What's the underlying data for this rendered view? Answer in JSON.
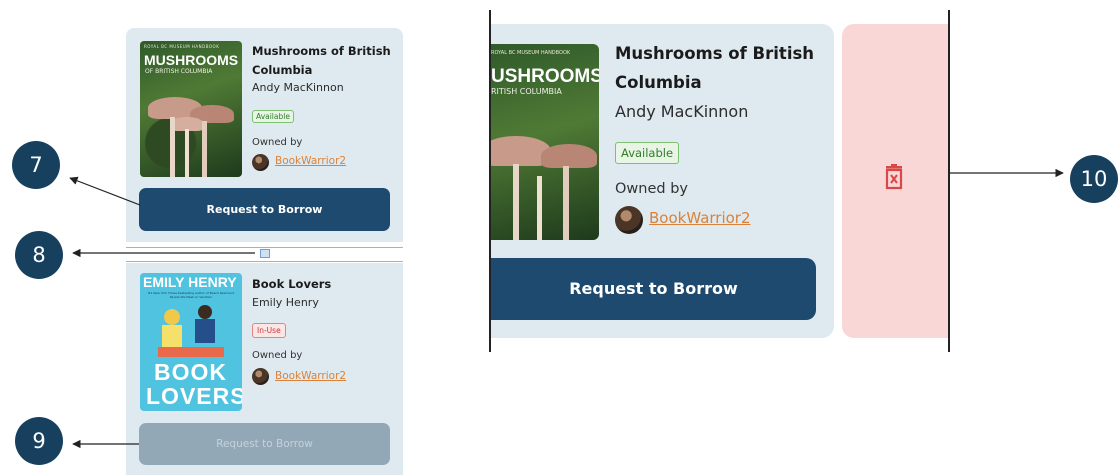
{
  "left_cards": [
    {
      "cover": {
        "series": "ROYAL BC MUSEUM HANDBOOK",
        "title_line1": "MUSHROOMS",
        "title_line2": "OF BRITISH COLUMBIA"
      },
      "title": "Mushrooms of British Columbia",
      "author": "Andy MacKinnon",
      "status": "Available",
      "owned_by": "Owned by",
      "owner": "BookWarrior2",
      "button": "Request to Borrow",
      "button_state": "enabled"
    },
    {
      "cover": {
        "author_line": "EMILY HENRY",
        "tagline": "#1 New York Times bestselling author of Beach Read and People We Meet on Vacation",
        "title_line1": "BOOK",
        "title_line2": "LOVERS"
      },
      "title": "Book Lovers",
      "author": "Emily Henry",
      "status": "In-Use",
      "owned_by": "Owned by",
      "owner": "BookWarrior2",
      "button": "Request to Borrow",
      "button_state": "disabled"
    }
  ],
  "zoom_card": {
    "cover": {
      "series": "ROYAL BC MUSEUM HANDBOOK",
      "title_line1": "USHROOMS",
      "title_line2": "RITISH COLUMBIA"
    },
    "title_line1": "Mushrooms of British",
    "title_line2": "Columbia",
    "author": "Andy MacKinnon",
    "status": "Available",
    "owned_by": "Owned by",
    "owner": "BookWarrior2",
    "button": "Request to Borrow"
  },
  "delete_icon": "trash-x-icon",
  "markers": {
    "m7": "7",
    "m8": "8",
    "m9": "9",
    "m10": "10"
  },
  "colors": {
    "card_bg": "#dfe9f0",
    "primary": "#1d4a6e",
    "disabled": "#93a8b7",
    "marker": "#17405f",
    "delete_bg": "#f9d7d7",
    "delete_icon": "#d94848",
    "owner_link": "#d9823a"
  }
}
